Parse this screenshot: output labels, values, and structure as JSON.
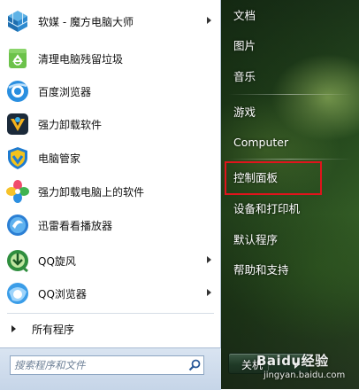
{
  "left_menu": {
    "programs": [
      {
        "label": "软媒 - 魔方电脑大师",
        "icon": "cube-master-icon",
        "submenu": true
      },
      {
        "label": "清理电脑残留垃圾",
        "icon": "recycle-bin-icon",
        "submenu": false
      },
      {
        "label": "百度浏览器",
        "icon": "baidu-browser-icon",
        "submenu": false
      },
      {
        "label": "强力卸载软件",
        "icon": "uninstaller-icon",
        "submenu": false
      },
      {
        "label": "电脑管家",
        "icon": "shield-icon",
        "submenu": false
      },
      {
        "label": "强力卸载电脑上的软件",
        "icon": "pinwheel-icon",
        "submenu": false
      },
      {
        "label": "迅雷看看播放器",
        "icon": "xunlei-player-icon",
        "submenu": false
      },
      {
        "label": "QQ旋风",
        "icon": "qq-whirlwind-icon",
        "submenu": true
      },
      {
        "label": "QQ浏览器",
        "icon": "qq-browser-icon",
        "submenu": true
      }
    ],
    "all_programs": "所有程序",
    "search_placeholder": "搜索程序和文件"
  },
  "right_menu": {
    "items": [
      "文档",
      "图片",
      "音乐",
      "游戏",
      "Computer",
      "控制面板",
      "设备和打印机",
      "默认程序",
      "帮助和支持"
    ],
    "highlighted": "控制面板"
  },
  "shutdown": {
    "label": "关机"
  },
  "watermark": {
    "brand": "Baidu经验",
    "url": "jingyan.baidu.com"
  },
  "colors": {
    "highlight_box": "#e0141c",
    "menu_bg": "#ffffff",
    "search_bar": "#d9e4f1"
  }
}
